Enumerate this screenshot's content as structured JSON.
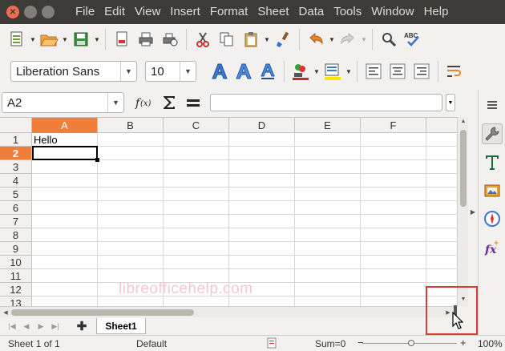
{
  "menu": [
    "File",
    "Edit",
    "View",
    "Insert",
    "Format",
    "Sheet",
    "Data",
    "Tools",
    "Window",
    "Help"
  ],
  "font": {
    "name": "Liberation Sans",
    "size": "10"
  },
  "formula_bar": {
    "name_box": "A2",
    "input": ""
  },
  "columns": [
    "A",
    "B",
    "C",
    "D",
    "E",
    "F"
  ],
  "rows": [
    "1",
    "2",
    "3",
    "4",
    "5",
    "6",
    "7",
    "8",
    "9",
    "10",
    "11",
    "12",
    "13"
  ],
  "selected": {
    "column": "A",
    "row": "2"
  },
  "cells": {
    "A1": "Hello"
  },
  "watermark": "libreofficehelp.com",
  "sheet_tabs": [
    "Sheet1"
  ],
  "status": {
    "sheet": "Sheet 1 of 1",
    "style": "Default",
    "sum": "Sum=0",
    "zoom": "100%"
  },
  "colors": {
    "accent": "#ef7f39",
    "highlight_box": "#d93a3a",
    "titlebar": "#3c3b37"
  }
}
